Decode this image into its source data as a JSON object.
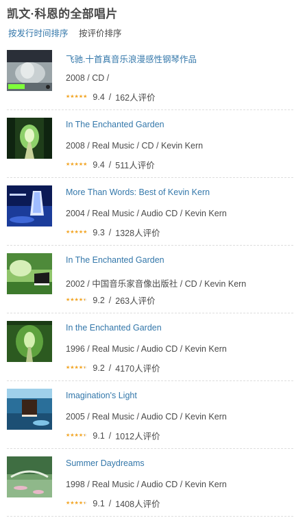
{
  "page": {
    "title": "凯文·科恩的全部唱片"
  },
  "sort": {
    "by_date": "按发行时间排序",
    "by_rating": "按评价排序"
  },
  "separator": "/",
  "stars_icon": "★★★★★",
  "colors": {
    "link": "#3377aa",
    "star": "#f5a623",
    "text": "#494949"
  },
  "albums": [
    {
      "title": "飞驰.十首真音乐浪漫感性钢琴作品",
      "meta": "2008 / CD /",
      "score": "9.4",
      "star_fraction": 1.0,
      "votes": "162人评价",
      "cover_icon": "horse-piano-cover"
    },
    {
      "title": "In The Enchanted Garden",
      "meta": "2008 / Real Music / CD / Kevin Kern",
      "score": "9.4",
      "star_fraction": 1.0,
      "votes": "511人评价",
      "cover_icon": "garden-path-cover"
    },
    {
      "title": "More Than Words: Best of Kevin Kern",
      "meta": "2004 / Real Music / Audio CD / Kevin Kern",
      "score": "9.3",
      "star_fraction": 1.0,
      "votes": "1328人评价",
      "cover_icon": "waterfall-cover"
    },
    {
      "title": "In The Enchanted Garden",
      "meta": "2002 / 中国音乐家音像出版社 / CD / Kevin Kern",
      "score": "9.2",
      "star_fraction": 0.9,
      "votes": "263人评价",
      "cover_icon": "garden-piano-cover"
    },
    {
      "title": "In the Enchanted Garden",
      "meta": "1996 / Real Music / Audio CD / Kevin Kern",
      "score": "9.2",
      "star_fraction": 0.9,
      "votes": "4170人评价",
      "cover_icon": "garden-tunnel-cover"
    },
    {
      "title": "Imagination's Light",
      "meta": "2005 / Real Music / Audio CD / Kevin Kern",
      "score": "9.1",
      "star_fraction": 0.9,
      "votes": "1012人评价",
      "cover_icon": "piano-seascape-cover"
    },
    {
      "title": "Summer Daydreams",
      "meta": "1998 / Real Music / Audio CD / Kevin Kern",
      "score": "9.1",
      "star_fraction": 0.9,
      "votes": "1408人评价",
      "cover_icon": "monet-bridge-cover"
    }
  ]
}
